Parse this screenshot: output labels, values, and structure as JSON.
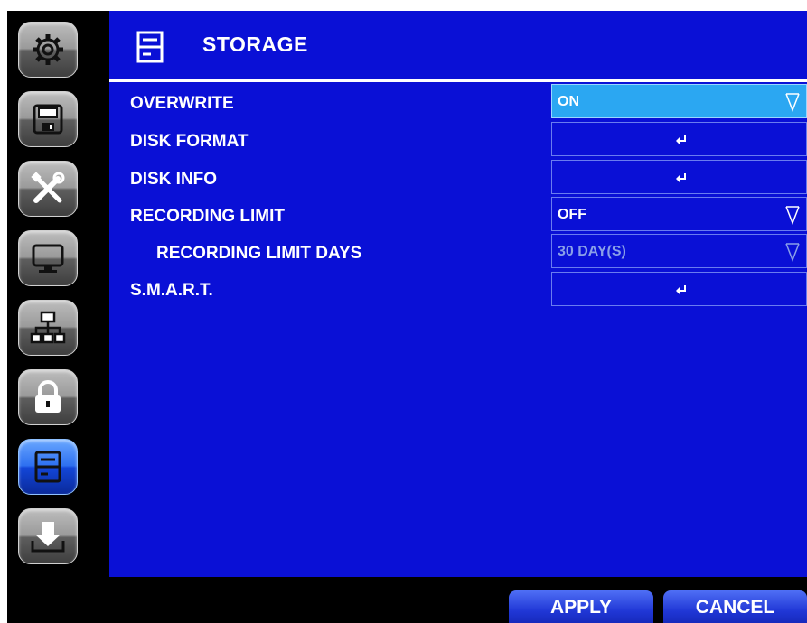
{
  "header": {
    "title": "STORAGE",
    "icon": "storage-icon"
  },
  "sidebar": {
    "items": [
      {
        "name": "settings",
        "icon": "gear-icon"
      },
      {
        "name": "record",
        "icon": "floppy-disk-icon"
      },
      {
        "name": "tools",
        "icon": "tools-icon"
      },
      {
        "name": "display",
        "icon": "monitor-icon"
      },
      {
        "name": "network",
        "icon": "network-icon"
      },
      {
        "name": "security",
        "icon": "lock-icon"
      },
      {
        "name": "storage",
        "icon": "storage-icon",
        "active": true
      },
      {
        "name": "download",
        "icon": "download-icon"
      }
    ]
  },
  "rows": [
    {
      "label": "OVERWRITE",
      "control": "dropdown",
      "value": "ON",
      "state": "selected"
    },
    {
      "label": "DISK FORMAT",
      "control": "enter"
    },
    {
      "label": "DISK INFO",
      "control": "enter"
    },
    {
      "label": "RECORDING LIMIT",
      "control": "dropdown",
      "value": "OFF"
    },
    {
      "label": "RECORDING LIMIT DAYS",
      "control": "dropdown",
      "value": "30 DAY(S)",
      "state": "disabled"
    },
    {
      "label": "S.M.A.R.T.",
      "control": "enter"
    }
  ],
  "footer": {
    "apply_label": "APPLY",
    "cancel_label": "CANCEL"
  },
  "colors": {
    "panel": "#0a10d6",
    "selected": "#2ba7f2",
    "disabled_text": "#8aa0e8"
  }
}
